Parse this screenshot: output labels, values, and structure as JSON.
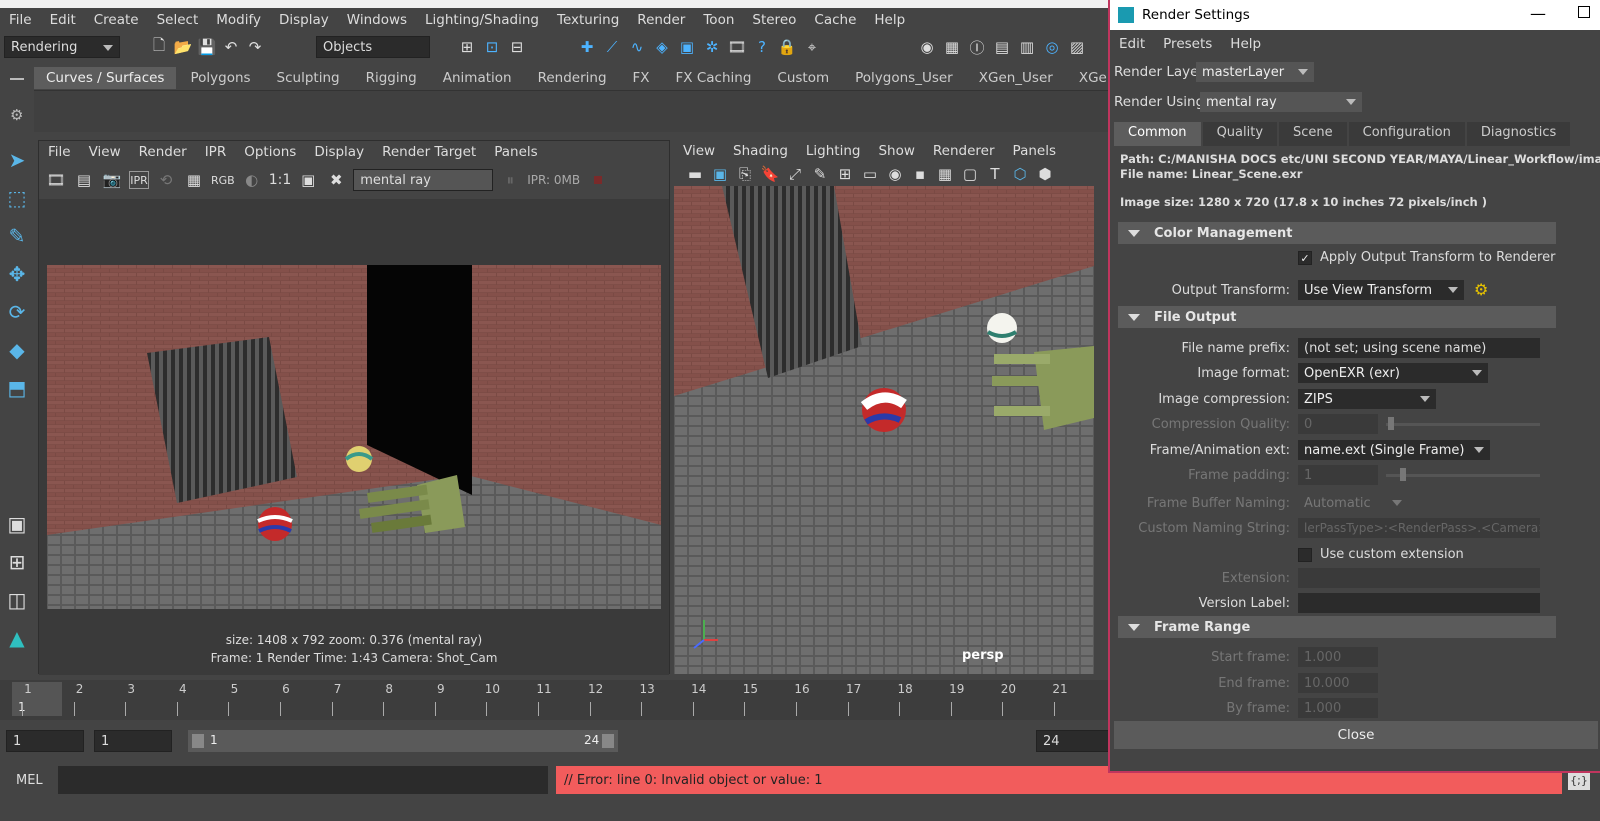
{
  "menubar": [
    "File",
    "Edit",
    "Create",
    "Select",
    "Modify",
    "Display",
    "Windows",
    "Lighting/Shading",
    "Texturing",
    "Render",
    "Toon",
    "Stereo",
    "Cache",
    "Help"
  ],
  "toolrow": {
    "mode": "Rendering",
    "objects": "Objects"
  },
  "shelf_tabs": [
    "Curves / Surfaces",
    "Polygons",
    "Sculpting",
    "Rigging",
    "Animation",
    "Rendering",
    "FX",
    "FX Caching",
    "Custom",
    "Polygons_User",
    "XGen_User",
    "XGen"
  ],
  "render_view": {
    "menu": [
      "File",
      "View",
      "Render",
      "IPR",
      "Options",
      "Display",
      "Render Target",
      "Panels"
    ],
    "tools": {
      "rgb": "RGB",
      "ratio": "1:1",
      "renderer": "mental ray",
      "ipr": "IPR: 0MB"
    },
    "status_line1": "size: 1408 x 792 zoom: 0.376        (mental ray)",
    "status_line2": "Frame: 1      Render Time: 1:43      Camera:  Shot_Cam"
  },
  "viewport": {
    "menu": [
      "View",
      "Shading",
      "Lighting",
      "Show",
      "Renderer",
      "Panels"
    ],
    "camera_label": "persp"
  },
  "timeline": {
    "ticks": [
      "1",
      "2",
      "3",
      "4",
      "5",
      "6",
      "7",
      "8",
      "9",
      "10",
      "11",
      "12",
      "13",
      "14",
      "15",
      "16",
      "17",
      "18",
      "19",
      "20",
      "21"
    ],
    "current": "1"
  },
  "range": {
    "start": "1",
    "start2": "1",
    "slider_start": "1",
    "slider_end": "24",
    "end": "24"
  },
  "cmdline": {
    "label": "MEL",
    "error": "// Error: line 0: Invalid object or value: 1"
  },
  "render_settings": {
    "title": "Render Settings",
    "menu": [
      "Edit",
      "Presets",
      "Help"
    ],
    "render_layer_label": "Render Layer",
    "render_layer": "masterLayer",
    "render_using_label": "Render Using",
    "render_using": "mental ray",
    "tabs": [
      "Common",
      "Quality",
      "Scene",
      "Configuration",
      "Diagnostics"
    ],
    "path": "Path: C:/MANISHA DOCS etc/UNI SECOND YEAR/MAYA/Linear_Workflow/images/",
    "file_name": "File name:  Linear_Scene.exr",
    "image_size": "Image size: 1280 x 720 (17.8 x 10 inches 72 pixels/inch )",
    "sections": {
      "color_management": "Color Management",
      "file_output": "File Output",
      "frame_range": "Frame Range"
    },
    "apply_output_transform": "Apply Output Transform to Renderer",
    "output_transform_label": "Output Transform:",
    "output_transform": "Use View Transform",
    "fields": {
      "prefix_label": "File name prefix:",
      "prefix": "(not set; using scene name)",
      "format_label": "Image format:",
      "format": "OpenEXR (exr)",
      "compression_label": "Image compression:",
      "compression": "ZIPS",
      "quality_label": "Compression Quality:",
      "quality": "0",
      "ext_label": "Frame/Animation ext:",
      "ext": "name.ext (Single Frame)",
      "padding_label": "Frame padding:",
      "padding": "1",
      "buffer_label": "Frame Buffer Naming:",
      "buffer": "Automatic",
      "custom_label": "Custom Naming String:",
      "custom": "lerPassType>:<RenderPass>.<Camera>",
      "use_custom_ext": "Use custom extension",
      "extension_label": "Extension:",
      "version_label": "Version Label:",
      "start_label": "Start frame:",
      "start": "1.000",
      "end_label": "End frame:",
      "end": "10.000",
      "by_label": "By frame:",
      "by": "1.000"
    },
    "close": "Close"
  }
}
